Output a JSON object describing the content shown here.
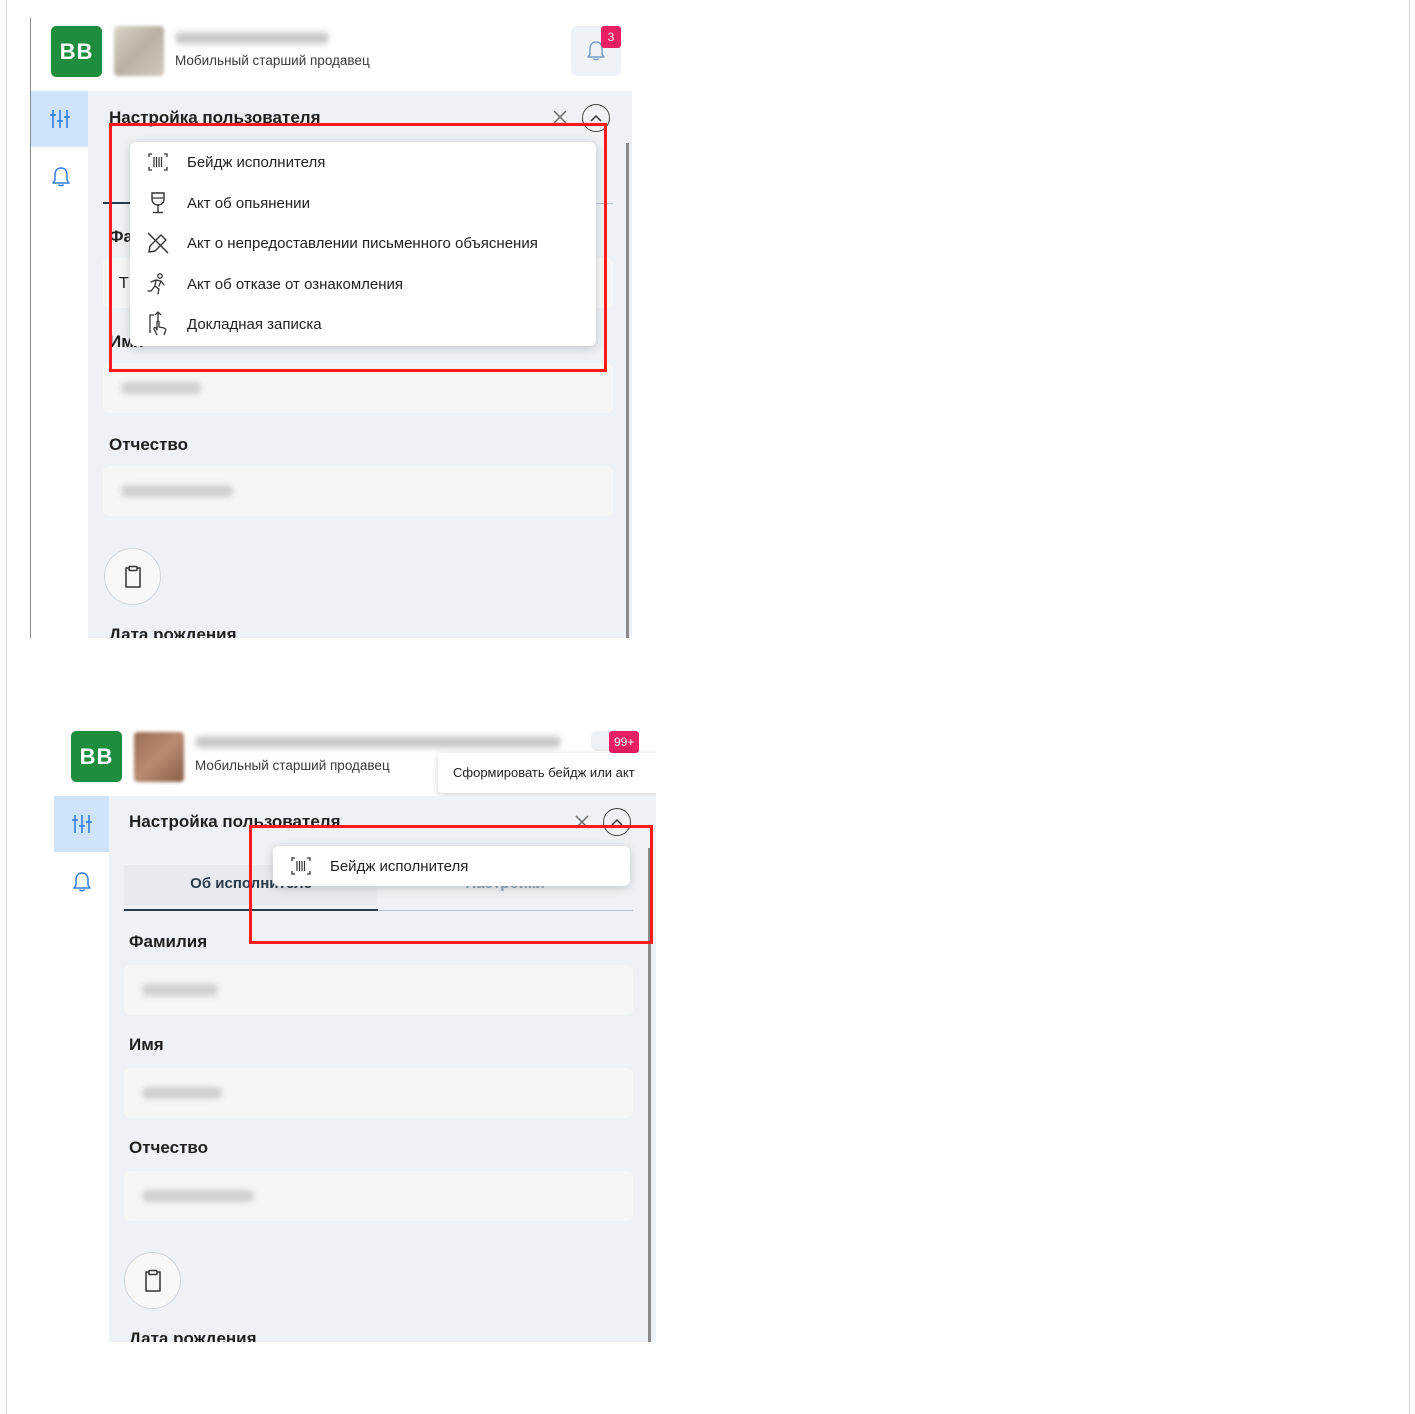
{
  "screens": [
    {
      "header": {
        "logo_text": "BB",
        "user_role": "Мобильный старший продавец",
        "notification_count": "3"
      },
      "panel": {
        "title": "Настройка пользователя",
        "fields": [
          {
            "label": "Фамилия",
            "value_initial": "Т"
          },
          {
            "label": "Имя"
          },
          {
            "label": "Отчество"
          },
          {
            "label": "Дата рождения"
          }
        ]
      },
      "menu": {
        "items": [
          {
            "label": "Бейдж исполнителя",
            "icon": "barcode-icon"
          },
          {
            "label": "Акт об опьянении",
            "icon": "wine-glass-icon"
          },
          {
            "label": "Акт о непредоставлении письменного объяснения",
            "icon": "pencil-crossed-icon"
          },
          {
            "label": "Акт об отказе от ознакомления",
            "icon": "running-person-icon"
          },
          {
            "label": "Докладная записка",
            "icon": "hand-upload-icon"
          }
        ]
      }
    },
    {
      "header": {
        "logo_text": "BB",
        "user_role": "Мобильный старший продавец",
        "notification_count": "99+",
        "tooltip": "Сформировать бейдж или акт"
      },
      "panel": {
        "title": "Настройка пользователя",
        "tabs": [
          {
            "label": "Об исполнителе",
            "active": true
          },
          {
            "label": "Настройки",
            "active": false
          }
        ],
        "fields": [
          {
            "label": "Фамилия"
          },
          {
            "label": "Имя"
          },
          {
            "label": "Отчество"
          },
          {
            "label": "Дата рождения"
          }
        ]
      },
      "menu": {
        "items": [
          {
            "label": "Бейдж исполнителя",
            "icon": "barcode-icon"
          }
        ]
      }
    }
  ],
  "colors": {
    "brand_green": "#1e8e3e",
    "badge_pink": "#e91e63",
    "highlight_red": "#ff1a1a",
    "sidebar_active": "#cfe3fb",
    "panel_bg": "#eef1f5"
  }
}
